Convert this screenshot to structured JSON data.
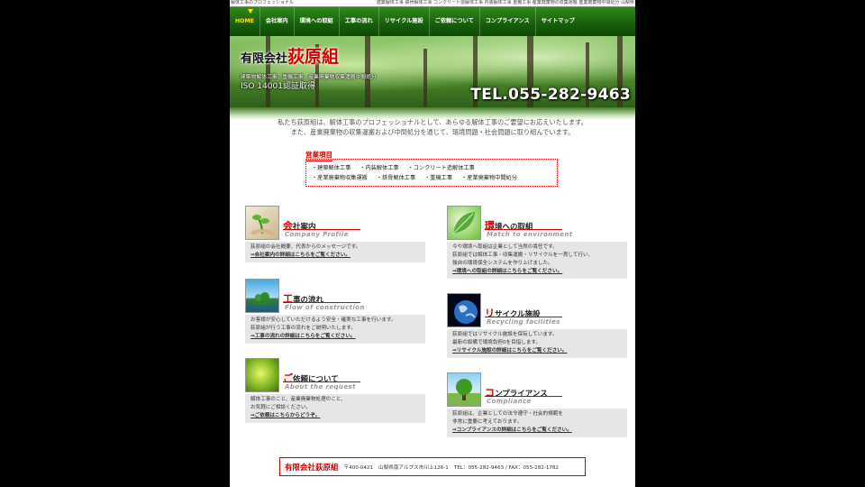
{
  "topbar": {
    "left": "解体工事のプロフェッショナル",
    "right": "建築解体工事 鉄骨解体工事 コンクリート造解体工事 内装解体工事 重機工事 産業廃棄物の収集運搬 産業廃棄物中間処分 山梨県"
  },
  "nav": {
    "items": [
      "HOME",
      "会社案内",
      "環境への取組",
      "工事の流れ",
      "リサイクル施設",
      "ご依頼について",
      "コンプライアンス",
      "サイトマップ"
    ]
  },
  "hero": {
    "company_prefix": "有限会社",
    "company_name": "荻原組",
    "sub": "建築物解体工事、重機工事、産業廃棄物収集運搬中間処分",
    "iso": "ISO 14001認証取得",
    "tel": "TEL.055-282-9463"
  },
  "intro": {
    "line1": "私たち荻原組は、解体工事のプロフェッショナルとして、あらゆる解体工事のご要望にお応えいたします。",
    "line2": "また、産業廃棄物の収集運搬および中間処分を通じて、環境問題・社会問題に取り組んでいます。"
  },
  "business": {
    "title": "営業項目",
    "row1": [
      "・建築解体工事",
      "・内装解体工事",
      "・コンクリート造解体工事"
    ],
    "row2": [
      "・産業廃棄物収集運搬",
      "・鉄骨解体工事",
      "・重機工事",
      "・産業廃棄物中間処分"
    ]
  },
  "cards": {
    "company": {
      "first": "会",
      "rest": "社案内",
      "en": "Company Profile",
      "text": "荻原組の会社概要、代表からのメッセージです。",
      "link": "⇒会社案内の詳細はこちらをご覧ください。"
    },
    "environment": {
      "first": "環",
      "rest": "境への取組",
      "en": "Match to environment",
      "text1": "今や環境へ取組は企業として当然の責任です。",
      "text2": "荻原組では解体工事・収集運搬・リサイクルを一貫して行い、",
      "text3": "独自の環境保全システムを作り上げました。",
      "link": "⇒環境への取組の詳細はこちらをご覧ください。"
    },
    "flow": {
      "first": "工",
      "rest": "事の流れ",
      "en": "Flow of construction",
      "text1": "お客様が安心していただけるよう安全・確実な工事を行います。",
      "text2": "荻原組が行う工事の流れをご説明いたします。",
      "link": "⇒工事の流れの詳細はこちらをご覧ください。"
    },
    "recycle": {
      "first": "リ",
      "rest": "サイクル施設",
      "en": "Recycling facilities",
      "text1": "荻原組ではリサイクル施設を保有しています。",
      "text2": "最新の設備で環境負担0を目指します。",
      "link": "⇒リサイクル施設の詳細はこちらをご覧ください。"
    },
    "request": {
      "first": "ご",
      "rest": "依頼について",
      "en": "About the request",
      "text1": "解体工事のこと、産業廃棄物処理のこと、",
      "text2": "お気軽にご相談ください。",
      "link": "⇒ご依頼はこちらからどうぞ。"
    },
    "compliance": {
      "first": "コ",
      "rest": "ンプライアンス",
      "en": "Compliance",
      "text1": "荻原組は、企業としての法令遵守・社会的規範を",
      "text2": "非常に重要に考えております。",
      "link": "⇒コンプライアンスの詳細はこちらをご覧ください。"
    }
  },
  "footer": {
    "name": "有限会社荻原組",
    "postal": "〒400-0421",
    "address": "山梨県南アルプス市川上126-1",
    "tel": "TEL：055-282-9463 / FAX：055-282-1782"
  },
  "colors": {
    "accent": "#d40000",
    "nav": "#165e0a",
    "nav_active": "#ffe600"
  }
}
